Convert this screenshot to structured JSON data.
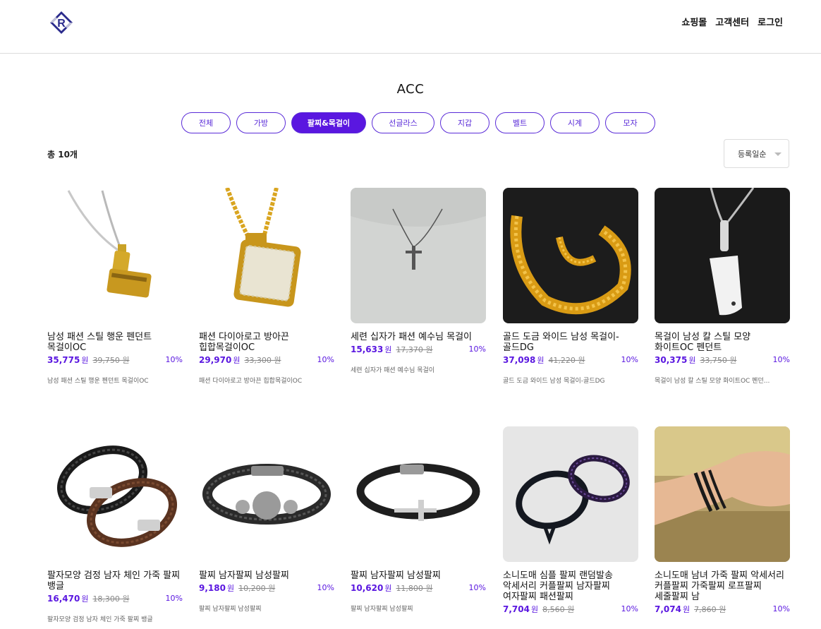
{
  "header": {
    "nav": [
      "쇼핑몰",
      "고객센터",
      "로그인"
    ]
  },
  "page": {
    "title": "ACC",
    "total": "총 10개",
    "sort": "등록일순"
  },
  "tabs": [
    {
      "label": "전체",
      "active": false
    },
    {
      "label": "가방",
      "active": false
    },
    {
      "label": "팔찌&목걸이",
      "active": true
    },
    {
      "label": "선글라스",
      "active": false
    },
    {
      "label": "지갑",
      "active": false
    },
    {
      "label": "벨트",
      "active": false
    },
    {
      "label": "시계",
      "active": false
    },
    {
      "label": "모자",
      "active": false
    }
  ],
  "products": [
    {
      "name": "남성 패션 스틸 행운 펜던트 목걸이OC",
      "price": "35,775",
      "unit": "원",
      "original": "39,750 원",
      "discount": "10%",
      "desc": "남성 패션 스틸 행운 펜던트 목걸이OC",
      "image": "hammer-pendant-necklace"
    },
    {
      "name": "패션 다이아로고 방아끈 힙합목걸이OC",
      "price": "29,970",
      "unit": "원",
      "original": "33,300 원",
      "discount": "10%",
      "desc": "패션 다이아로고 방아끈 힙합목걸이OC",
      "image": "diamond-tag-necklace"
    },
    {
      "name": "세련 십자가 패션 예수님 목걸이",
      "price": "15,633",
      "unit": "원",
      "original": "17,370 원",
      "discount": "10%",
      "desc": "세련 십자가 패션 예수님 목걸이",
      "image": "cross-necklace"
    },
    {
      "name": "골드 도금 와이드 남성 목걸이-골드DG",
      "price": "37,098",
      "unit": "원",
      "original": "41,220 원",
      "discount": "10%",
      "desc": "골드 도금 와이드 남성 목걸이-골드DG",
      "image": "gold-chain-necklace"
    },
    {
      "name": "목걸이 남성 칼 스틸 모양 화이트OC 펜던트",
      "price": "30,375",
      "unit": "원",
      "original": "33,750 원",
      "discount": "10%",
      "desc": "목걸이 남성 칼 스틸 모양 화이트OC 펜던...",
      "image": "knife-pendant-necklace"
    },
    {
      "name": "팔자모양 검정 남자 체인 가죽 팔찌 뱅글",
      "price": "16,470",
      "unit": "원",
      "original": "18,300 원",
      "discount": "10%",
      "desc": "팔자모양 검정 남자 체인 가죽 팔찌 뱅글",
      "image": "infinity-bracelets"
    },
    {
      "name": "팔찌 남자팔찌 남성팔찌",
      "price": "9,180",
      "unit": "원",
      "original": "10,200 원",
      "discount": "10%",
      "desc": "팔찌 남자팔찌 남성팔찌",
      "image": "skull-leather-bracelet"
    },
    {
      "name": "팔찌 남자팔찌 남성팔찌",
      "price": "10,620",
      "unit": "원",
      "original": "11,800 원",
      "discount": "10%",
      "desc": "팔찌 남자팔찌 남성팔찌",
      "image": "cross-leather-bracelet"
    },
    {
      "name": "소니도매 심플 팔찌 랜덤발송 악세서리 커플팔찌 남자팔찌 여자팔찌 패션팔찌",
      "price": "7,704",
      "unit": "원",
      "original": "8,560 원",
      "discount": "10%",
      "desc": "",
      "image": "anchor-bracelets"
    },
    {
      "name": "소니도매 남녀 가죽 팔찌 악세서리 커플팔찌 가죽팔찌 로프팔찌 세줄팔찌 남",
      "price": "7,074",
      "unit": "원",
      "original": "7,860 원",
      "discount": "10%",
      "desc": "",
      "image": "wrist-rope-bracelet"
    }
  ],
  "colors": {
    "accent": "#5a17e0",
    "border": "#dcdcdc"
  }
}
